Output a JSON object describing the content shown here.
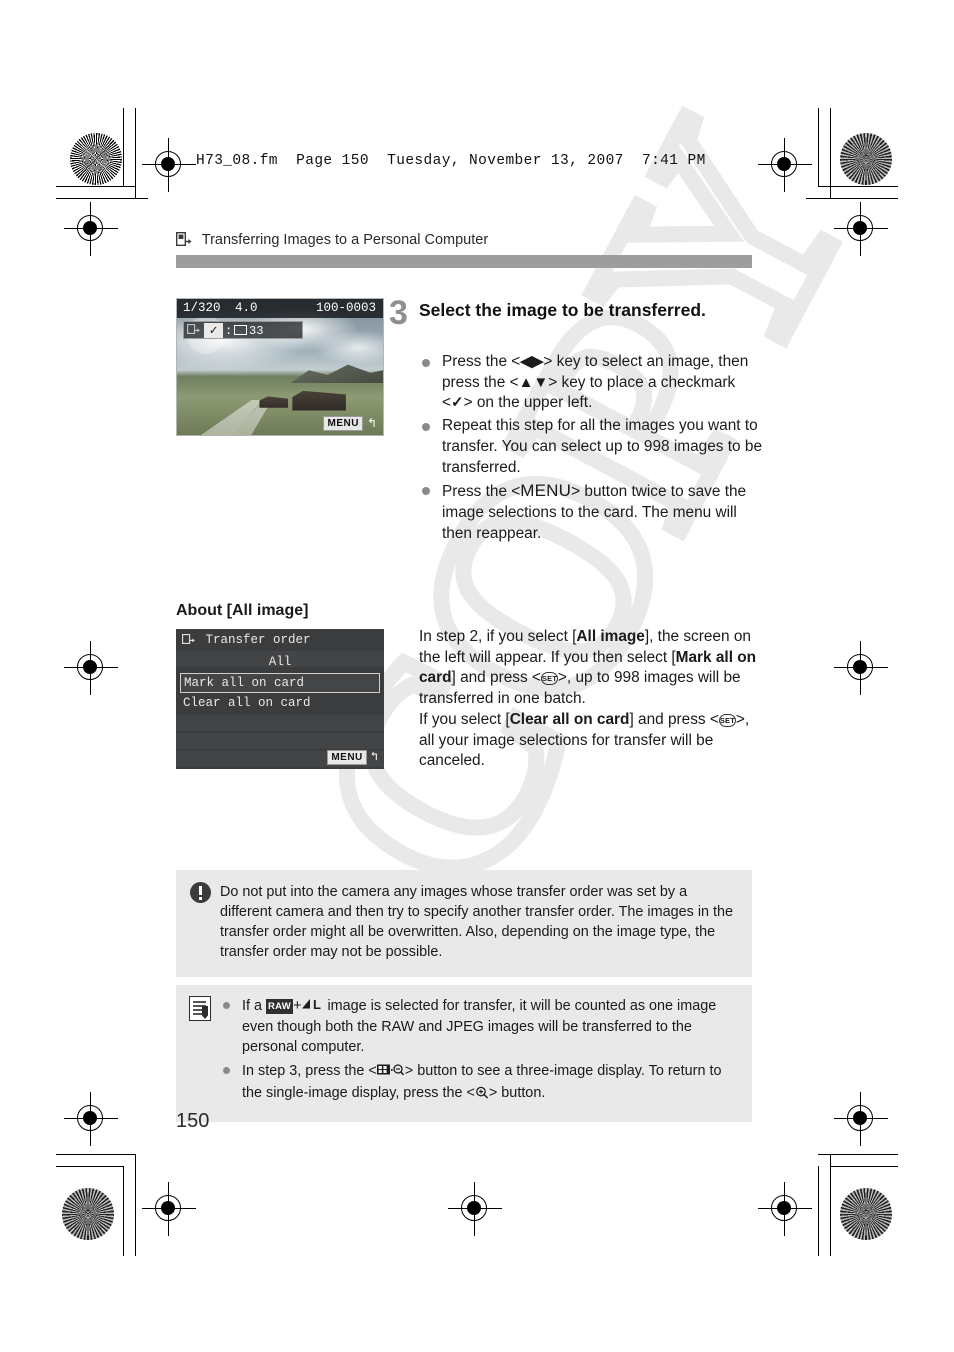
{
  "print_header": "H73_08.fm  Page 150  Tuesday, November 13, 2007  7:41 PM",
  "running_head": {
    "icon": "transfer-to-computer-icon",
    "title": "Transferring Images to a Personal Computer"
  },
  "step": {
    "number": "3",
    "title": "Select the image to be transferred.",
    "bullets": [
      {
        "id": "bullet-select-image",
        "parts": [
          {
            "t": "text",
            "v": "Press the <"
          },
          {
            "t": "glyph",
            "v": "◀▶"
          },
          {
            "t": "text",
            "v": "> key to select an image, then press the <"
          },
          {
            "t": "glyph",
            "v": "▲▼"
          },
          {
            "t": "text",
            "v": "> key to place a checkmark <"
          },
          {
            "t": "glyph",
            "v": "✓"
          },
          {
            "t": "text",
            "v": "> on the upper left."
          }
        ]
      },
      {
        "id": "bullet-repeat-step",
        "parts": [
          {
            "t": "text",
            "v": "Repeat this step for all the images you want to transfer. You can select up to 998 images to be transferred."
          }
        ]
      },
      {
        "id": "bullet-press-menu",
        "parts": [
          {
            "t": "text",
            "v": "Press the <"
          },
          {
            "t": "menu",
            "v": "MENU"
          },
          {
            "t": "text",
            "v": "> button twice to save the image selections to the card. The menu will then reappear."
          }
        ]
      }
    ]
  },
  "lcd_playback": {
    "shutter_speed": "1/320",
    "aperture": "4.0",
    "folder_file": "100-0003",
    "transfer_order_icon": "transfer-order-icon",
    "checkmark": "✓",
    "separator": ":",
    "image_count": "33",
    "menu_badge": "MENU",
    "return_glyph": "↰"
  },
  "about_section": {
    "heading": "About [All image]",
    "menu_screen": {
      "title": "Transfer order",
      "title_icon": "transfer-order-icon",
      "value": "All",
      "options": [
        {
          "label": "Mark all on card",
          "selected": true
        },
        {
          "label": "Clear all on card",
          "selected": false
        }
      ],
      "menu_badge": "MENU",
      "return_glyph": "↰"
    },
    "paragraph": [
      {
        "t": "text",
        "v": "In step 2, if you select ["
      },
      {
        "t": "bold",
        "v": "All image"
      },
      {
        "t": "text",
        "v": "], the screen on the left will appear. If you then select ["
      },
      {
        "t": "bold",
        "v": "Mark all on card"
      },
      {
        "t": "text",
        "v": "] and press <"
      },
      {
        "t": "set",
        "v": "SET"
      },
      {
        "t": "text",
        "v": ">, up to 998 images will be transferred in one batch."
      },
      {
        "t": "br",
        "v": ""
      },
      {
        "t": "text",
        "v": "If you select ["
      },
      {
        "t": "bold",
        "v": "Clear all on card"
      },
      {
        "t": "text",
        "v": "] and press <"
      },
      {
        "t": "set",
        "v": "SET"
      },
      {
        "t": "text",
        "v": ">, all your image selections for transfer will be canceled."
      }
    ]
  },
  "caution_box": {
    "icon": "caution-exclamation-icon",
    "text": "Do not put into the camera any images whose transfer order was set by a different camera and then try to specify another transfer order. The images in the transfer order might all be overwritten. Also, depending on the image type, the transfer order may not be possible."
  },
  "note_box": {
    "icon": "note-pen-icon",
    "bullets": [
      {
        "id": "note-raw-jpeg",
        "parts": [
          {
            "t": "text",
            "v": "If a "
          },
          {
            "t": "raw",
            "v": "RAW"
          },
          {
            "t": "text",
            "v": "+"
          },
          {
            "t": "quality",
            "v": "◢L"
          },
          {
            "t": "text",
            "v": " image is selected for transfer, it will be counted as one image even though both the RAW and JPEG images will be transferred to the personal computer."
          }
        ]
      },
      {
        "id": "note-three-image-display",
        "parts": [
          {
            "t": "text",
            "v": "In step 3, press the <"
          },
          {
            "t": "index",
            "v": "index-zoom-out-icon"
          },
          {
            "t": "text",
            "v": "> button to see a three-image display. To return to the single-image display, press the <"
          },
          {
            "t": "zoom",
            "v": "magnify-icon"
          },
          {
            "t": "text",
            "v": "> button."
          }
        ]
      }
    ]
  },
  "page_number": "150",
  "watermark": "COPY",
  "colors": {
    "header_bar": "#9d9d9d",
    "box_background": "#e9e9e9",
    "bullet_dot": "#8a8a8a",
    "step_number": "#8f8f8f",
    "menu_screen_bg": "#3a3c3e"
  }
}
